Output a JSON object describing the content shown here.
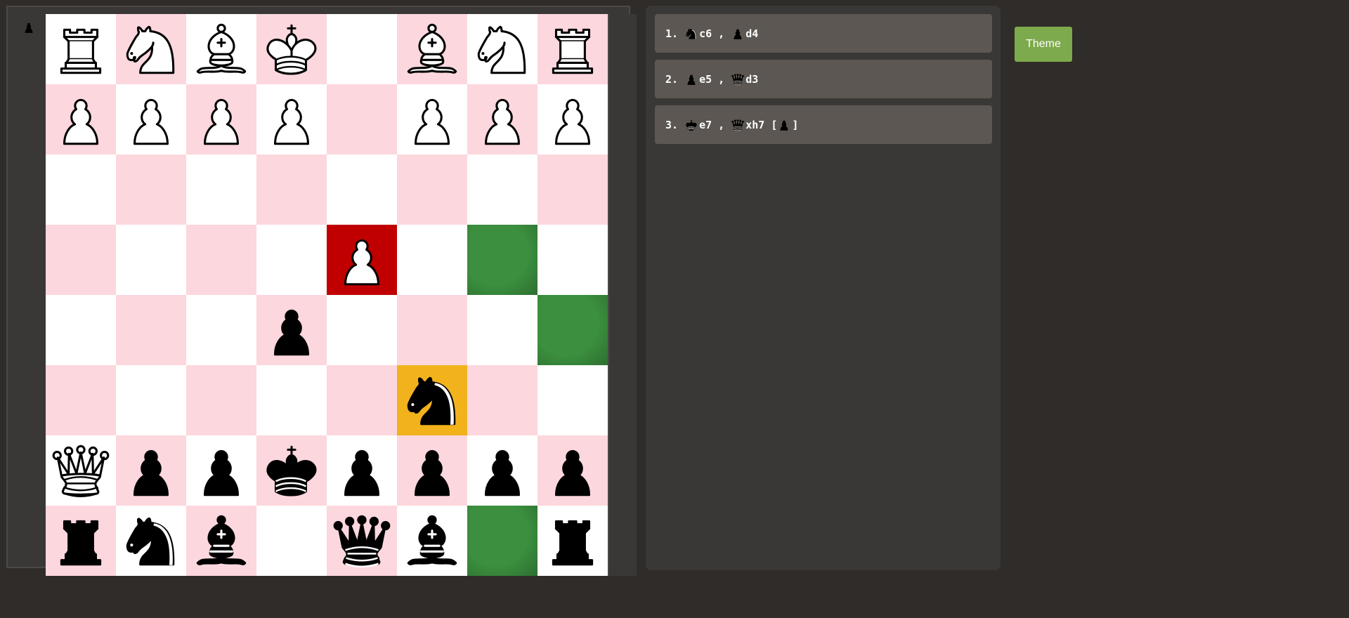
{
  "colors": {
    "light": "#ffffff",
    "dark": "#fcd7dd",
    "check": "#c00000",
    "last_move": "#f2b21c",
    "legal_move": "#3b8f3e"
  },
  "board": [
    [
      "wR",
      "wN",
      "wB",
      "wK",
      "",
      "wB",
      "wN",
      "wR"
    ],
    [
      "wP",
      "wP",
      "wP",
      "wP",
      "",
      "wP",
      "wP",
      "wP"
    ],
    [
      "",
      "",
      "",
      "",
      "",
      "",
      "",
      ""
    ],
    [
      "",
      "",
      "",
      "",
      "wP",
      "",
      "",
      ""
    ],
    [
      "",
      "",
      "",
      "bP",
      "",
      "",
      "",
      ""
    ],
    [
      "",
      "",
      "",
      "",
      "",
      "bN",
      "",
      ""
    ],
    [
      "wQ",
      "bP",
      "bP",
      "bK",
      "bP",
      "bP",
      "bP",
      "bP"
    ],
    [
      "bR",
      "bN",
      "bB",
      "",
      "bQ",
      "bB",
      "",
      "bR"
    ]
  ],
  "highlights": {
    "3,4": "check",
    "5,5": "last_move",
    "3,6": "legal_move",
    "4,7": "legal_move",
    "7,6": "legal_move"
  },
  "captured": [
    "bP"
  ],
  "moves": [
    {
      "num": "1.",
      "white": {
        "piece": "bN",
        "square": "c6"
      },
      "black": {
        "piece": "bP",
        "square": "d4"
      },
      "capture": ""
    },
    {
      "num": "2.",
      "white": {
        "piece": "bP",
        "square": "e5"
      },
      "black": {
        "piece": "bQ",
        "square": "d3"
      },
      "capture": ""
    },
    {
      "num": "3.",
      "white": {
        "piece": "bK",
        "square": "e7"
      },
      "black": {
        "piece": "bQ",
        "square": "xh7"
      },
      "capture": "bP"
    }
  ],
  "theme_button": "Theme"
}
